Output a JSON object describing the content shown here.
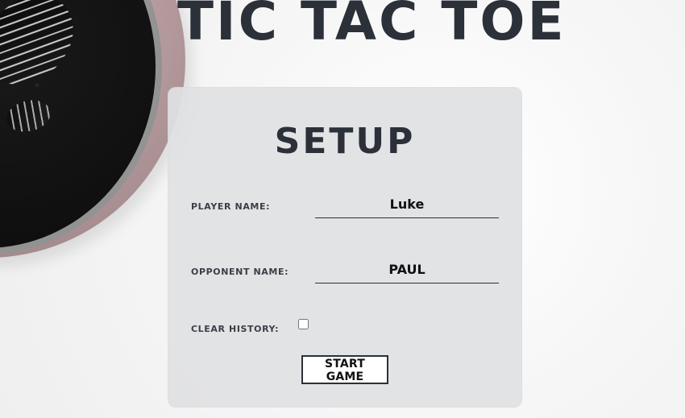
{
  "header": {
    "title": "TIC TAC TOE"
  },
  "setup": {
    "title": "SETUP",
    "player_name_label": "PLAYER NAME:",
    "player_name_value": "Luke",
    "opponent_name_label": "OPPONENT NAME:",
    "opponent_name_value": "PAUL",
    "clear_history_label": "CLEAR HISTORY:",
    "clear_history_checked": false,
    "start_button_label": "START GAME"
  },
  "colors": {
    "title_text": "#2b3039",
    "panel_bg": "#e0e1e3",
    "button_border": "#2b3039"
  },
  "decor": {
    "image_name": "plant-pot"
  }
}
